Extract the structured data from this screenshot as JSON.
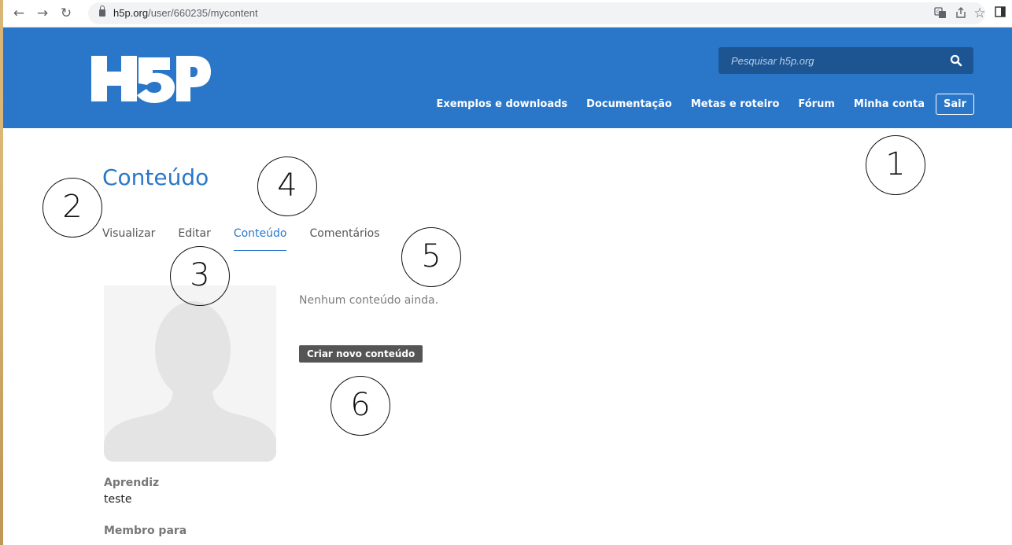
{
  "browser": {
    "back_icon": "←",
    "forward_icon": "→",
    "reload_icon": "↻",
    "url_host": "h5p.org",
    "url_path": "/user/660235/mycontent",
    "translate_icon": "translate-icon",
    "share_icon": "share-icon",
    "star_icon": "☆",
    "sidepanel_icon": "sidepanel-icon"
  },
  "header": {
    "logo_text": "H5P",
    "search_placeholder": "Pesquisar h5p.org",
    "nav": [
      {
        "label": "Exemplos e downloads"
      },
      {
        "label": "Documentação"
      },
      {
        "label": "Metas e roteiro"
      },
      {
        "label": "Fórum"
      },
      {
        "label": "Minha conta"
      }
    ],
    "logout_label": "Sair",
    "brand_color": "#2a77c9"
  },
  "page": {
    "title": "Conteúdo",
    "tabs": [
      {
        "label": "Visualizar"
      },
      {
        "label": "Editar"
      },
      {
        "label": "Conteúdo",
        "active": true
      },
      {
        "label": "Comentários"
      }
    ],
    "empty_message": "Nenhum conteúdo ainda.",
    "create_button": "Criar novo conteúdo",
    "profile": {
      "role_label": "Aprendiz",
      "name": "teste",
      "member_label": "Membro para"
    }
  },
  "callouts": [
    "1",
    "2",
    "3",
    "4",
    "5",
    "6"
  ]
}
